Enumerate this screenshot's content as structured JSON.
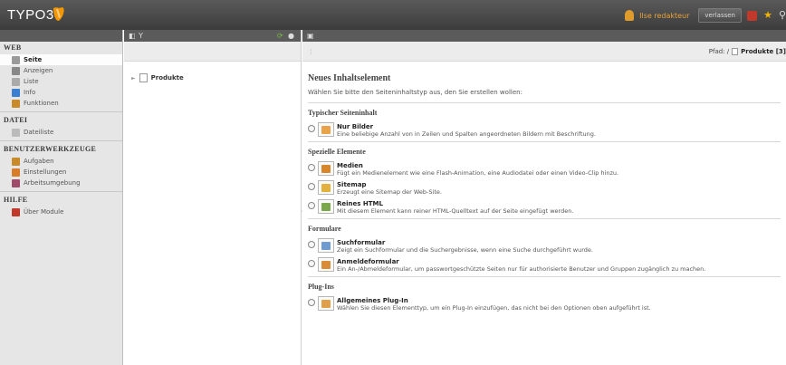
{
  "topbar": {
    "logo_text": "TYPO3",
    "user_name": "Ilse redakteur",
    "logout_label": "verlassen",
    "icons": [
      "user-icon",
      "clipboard-icon",
      "star-icon",
      "search-icon"
    ]
  },
  "modules": [
    {
      "title": "WEB",
      "items": [
        {
          "label": "Seite",
          "icon": "page-icon",
          "active": true
        },
        {
          "label": "Anzeigen",
          "icon": "view-icon",
          "active": false
        },
        {
          "label": "Liste",
          "icon": "list-icon",
          "active": false
        },
        {
          "label": "Info",
          "icon": "info-icon",
          "active": false
        },
        {
          "label": "Funktionen",
          "icon": "wand-icon",
          "active": false
        }
      ]
    },
    {
      "title": "DATEI",
      "items": [
        {
          "label": "Dateiliste",
          "icon": "folder-icon",
          "active": false
        }
      ]
    },
    {
      "title": "BENUTZERWERKZEUGE",
      "items": [
        {
          "label": "Aufgaben",
          "icon": "tasks-icon",
          "active": false
        },
        {
          "label": "Einstellungen",
          "icon": "settings-icon",
          "active": false
        },
        {
          "label": "Arbeitsumgebung",
          "icon": "workspace-icon",
          "active": false
        }
      ]
    },
    {
      "title": "HILFE",
      "items": [
        {
          "label": "Über Module",
          "icon": "help-book-icon",
          "active": false
        }
      ]
    }
  ],
  "tree": {
    "node_label": "Produkte"
  },
  "content": {
    "breadcrumb_prefix": "Pfad: /",
    "breadcrumb_page": "Produkte [3]",
    "heading": "Neues Inhaltselement",
    "intro": "Wählen Sie bitte den Seiteninhaltstyp aus, den Sie erstellen wollen:",
    "sections": [
      {
        "title": "Typischer Seiteninhalt",
        "options": [
          {
            "title": "Nur Bilder",
            "desc": "Eine beliebige Anzahl von in Zeilen und Spalten angeordneten Bildern mit Beschriftung.",
            "icon": "images-icon",
            "color": "#e8a24a"
          }
        ]
      },
      {
        "title": "Spezielle Elemente",
        "options": [
          {
            "title": "Medien",
            "desc": "Fügt ein Medienelement wie eine Flash-Animation, eine Audiodatei oder einen Video-Clip hinzu.",
            "icon": "media-icon",
            "color": "#d9862b"
          },
          {
            "title": "Sitemap",
            "desc": "Erzeugt eine Sitemap der Web-Site.",
            "icon": "sitemap-icon",
            "color": "#e2b13c"
          },
          {
            "title": "Reines HTML",
            "desc": "Mit diesem Element kann reiner HTML-Quelltext auf der Seite eingefügt werden.",
            "icon": "html-icon",
            "color": "#7aa84a"
          }
        ]
      },
      {
        "title": "Formulare",
        "options": [
          {
            "title": "Suchformular",
            "desc": "Zeigt ein Suchformular und die Suchergebnisse, wenn eine Suche durchgeführt wurde.",
            "icon": "search-form-icon",
            "color": "#6e9bd0"
          },
          {
            "title": "Anmeldeformular",
            "desc": "Ein An-/Abmeldeformular, um passwortgeschützte Seiten nur für authorisierte Benutzer und Gruppen zugänglich zu machen.",
            "icon": "login-form-icon",
            "color": "#d98b36"
          }
        ]
      },
      {
        "title": "Plug-Ins",
        "options": [
          {
            "title": "Allgemeines Plug-In",
            "desc": "Wählen Sie diesen Elementtyp, um ein Plug-In einzufügen, das nicht bei den Optionen oben aufgeführt ist.",
            "icon": "plugin-icon",
            "color": "#e0a04a"
          }
        ]
      }
    ]
  },
  "colors": {
    "topbar": "#444444",
    "accent": "#e8a33a",
    "panel": "#e6e6e6"
  }
}
